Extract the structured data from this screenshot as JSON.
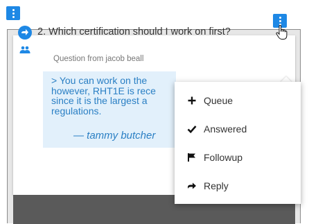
{
  "question": {
    "title": "2. Which certification should I work on first?",
    "from": "Question from jacob beall"
  },
  "answer": {
    "text": "> You can work on the\nhowever, RHT1E is rece\nsince it is the largest a\nregulations.",
    "author": "— tammy butcher"
  },
  "menu": {
    "items": [
      {
        "label": "Queue",
        "icon": "plus-icon"
      },
      {
        "label": "Answered",
        "icon": "checkmark-icon"
      },
      {
        "label": "Followup",
        "icon": "flag-icon"
      },
      {
        "label": "Reply",
        "icon": "arrow-right-icon"
      }
    ]
  },
  "colors": {
    "accent": "#1e88e5",
    "answer_bg": "#e2f0fb",
    "answer_text": "#2a7fc4"
  }
}
